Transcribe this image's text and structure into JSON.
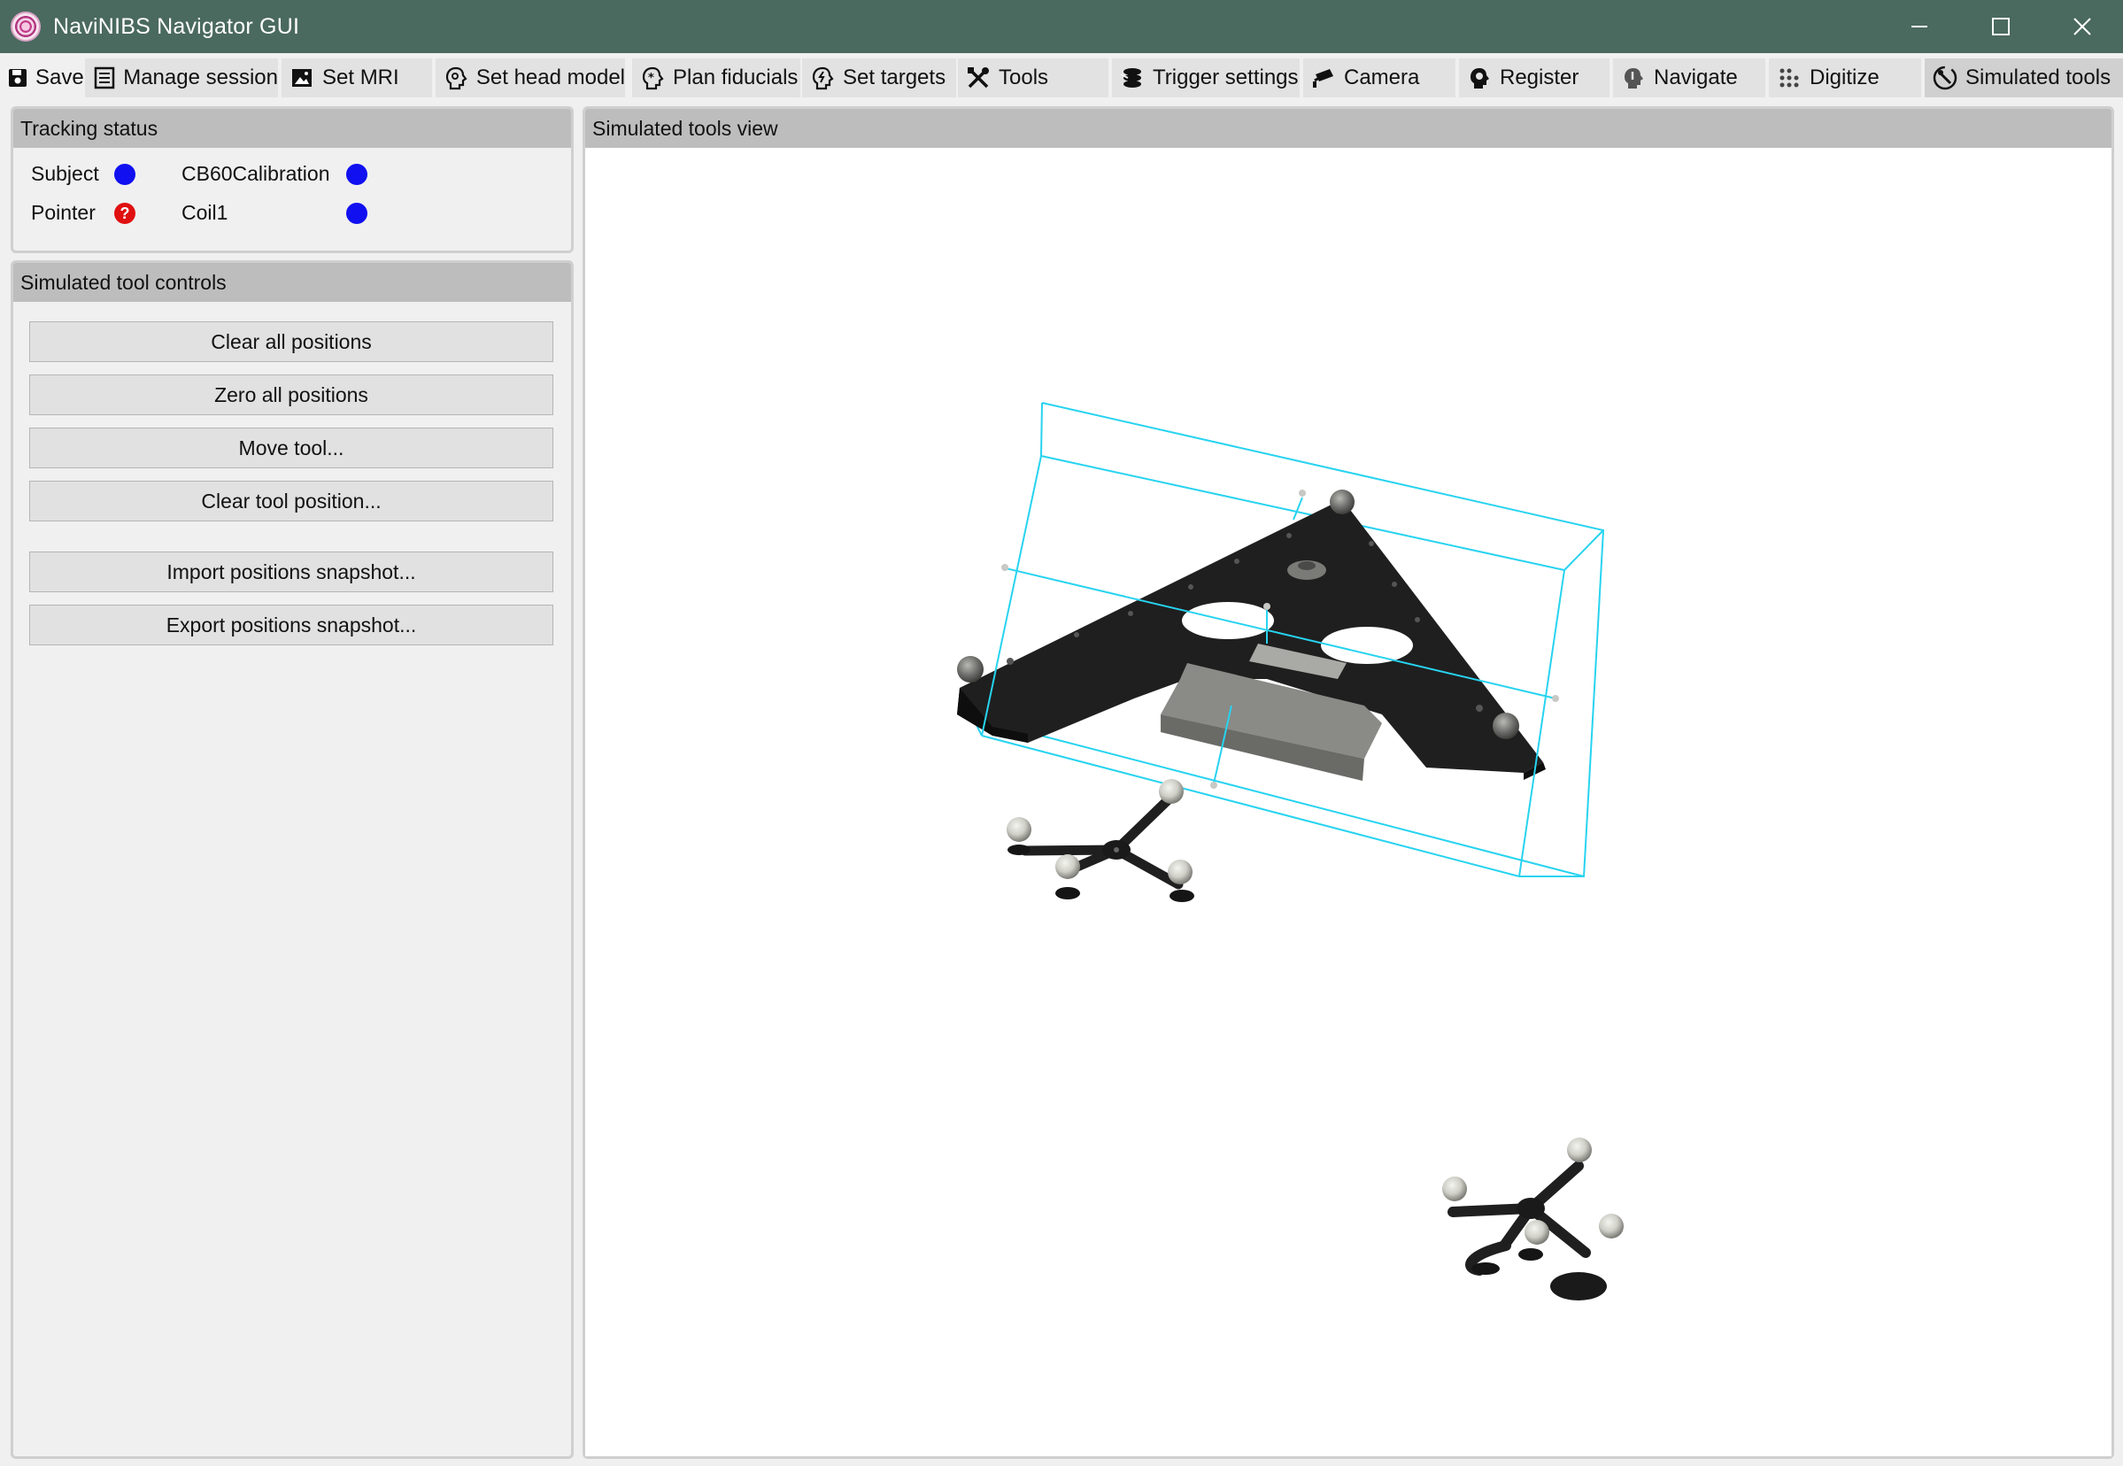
{
  "window": {
    "title": "NaviNIBS Navigator GUI",
    "controls": [
      "minimize-icon",
      "maximize-icon",
      "close-icon"
    ]
  },
  "tabs": [
    {
      "label": "Save",
      "icon": "save-icon"
    },
    {
      "label": "Manage session",
      "icon": "session-icon"
    },
    {
      "label": "Set MRI",
      "icon": "image-icon"
    },
    {
      "label": "Set head model",
      "icon": "head-model-icon"
    },
    {
      "label": "Plan fiducials",
      "icon": "fiducials-icon"
    },
    {
      "label": "Set targets",
      "icon": "targets-icon"
    },
    {
      "label": "Tools",
      "icon": "tools-icon"
    },
    {
      "label": "Trigger settings",
      "icon": "trigger-icon"
    },
    {
      "label": "Camera",
      "icon": "camera-icon"
    },
    {
      "label": "Register",
      "icon": "register-icon"
    },
    {
      "label": "Navigate",
      "icon": "navigate-icon"
    },
    {
      "label": "Digitize",
      "icon": "digitize-icon"
    },
    {
      "label": "Simulated tools",
      "icon": "simulated-tools-icon",
      "active": true
    }
  ],
  "tracking_status": {
    "title": "Tracking status",
    "items": [
      {
        "label": "Subject",
        "status": "tracked",
        "color": "#1010f0"
      },
      {
        "label": "CB60Calibration",
        "status": "tracked",
        "color": "#1010f0"
      },
      {
        "label": "Pointer",
        "status": "unknown",
        "color": "#e01010",
        "symbol": "?"
      },
      {
        "label": "Coil1",
        "status": "tracked",
        "color": "#1010f0"
      }
    ]
  },
  "controls": {
    "title": "Simulated tool controls",
    "buttons": [
      "Clear all positions",
      "Zero all positions",
      "Move tool...",
      "Clear tool position...",
      "Import positions snapshot...",
      "Export positions snapshot..."
    ]
  },
  "view": {
    "title": "Simulated tools view",
    "highlight_color": "#27d3f0"
  }
}
